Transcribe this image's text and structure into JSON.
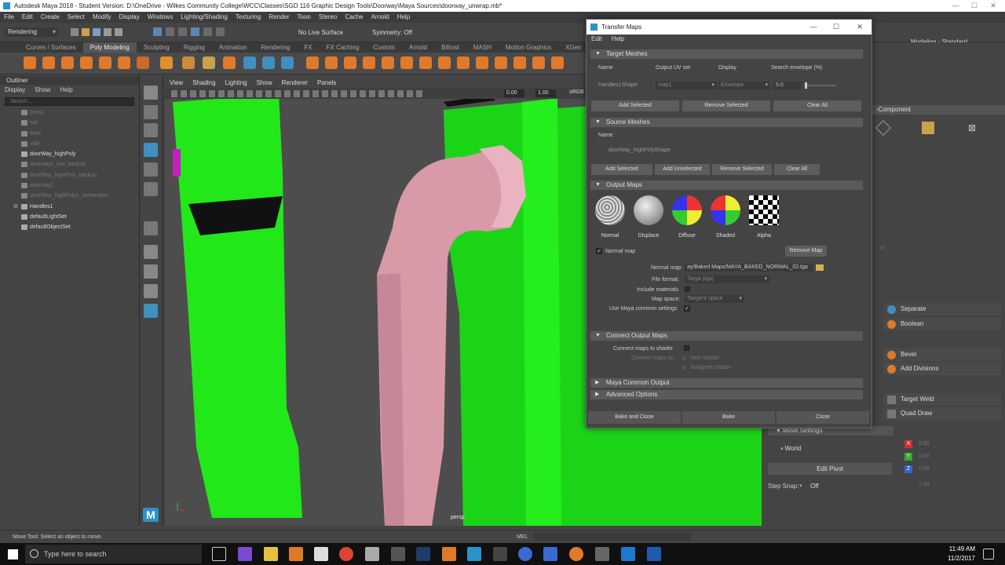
{
  "window": {
    "title": "Autodesk Maya 2018 - Student Version: D:\\OneDrive - Wilkes Community College\\WCC\\Classes\\SGD 116 Graphic Design Tools\\Doorway\\Maya Sources\\doorway_unwrap.mb*",
    "min": "—",
    "max": "☐",
    "close": "✕"
  },
  "menubar": [
    "File",
    "Edit",
    "Create",
    "Select",
    "Modify",
    "Display",
    "Windows",
    "Lighting/Shading",
    "Texturing",
    "Render",
    "Toon",
    "Stereo",
    "Cache",
    "Arnold",
    "Help"
  ],
  "statusline": {
    "menuset": "Rendering",
    "live_surface": "No Live Surface",
    "symmetry": "Symmetry: Off",
    "workspace": "Modeling - Standard"
  },
  "shelf_tabs": [
    "Curves / Surfaces",
    "Poly Modeling",
    "Sculpting",
    "Rigging",
    "Animation",
    "Rendering",
    "FX",
    "FX Caching",
    "Custom",
    "Arnold",
    "Bifrost",
    "MASH",
    "Motion Graphics",
    "XGen"
  ],
  "shelf_active": "Poly Modeling",
  "outliner": {
    "title": "Outliner",
    "menu": [
      "Display",
      "Show",
      "Help"
    ],
    "search_placeholder": "Search...",
    "items": [
      {
        "label": "persp",
        "dim": true
      },
      {
        "label": "top",
        "dim": true
      },
      {
        "label": "front",
        "dim": true
      },
      {
        "label": "side",
        "dim": true
      },
      {
        "label": "doorWay_highPoly",
        "dim": false
      },
      {
        "label": "doorway1_low_backup",
        "dim": true
      },
      {
        "label": "doorWay_highPoly_backup",
        "dim": true
      },
      {
        "label": "doorway1",
        "dim": true
      },
      {
        "label": "doorWay_highPoly1_noHandles",
        "dim": true
      },
      {
        "label": "Handles1",
        "dim": false
      },
      {
        "label": "defaultLightSet",
        "dim": false
      },
      {
        "label": "defaultObjectSet",
        "dim": false
      }
    ]
  },
  "viewport": {
    "menu": [
      "View",
      "Shading",
      "Lighting",
      "Show",
      "Renderer",
      "Panels"
    ],
    "field1": "0.00",
    "field2": "1.00",
    "colorspace": "sRGB",
    "camera_label": "persp"
  },
  "dialog": {
    "title": "Transfer Maps",
    "menu": [
      "Edit",
      "Help"
    ],
    "target": {
      "header": "Target Meshes",
      "col_name": "Name",
      "col_uv": "Output UV set",
      "col_display": "Display",
      "col_envelope": "Search envelope (%)",
      "row_name": "Handles1Shape",
      "row_uv": "map1",
      "row_display": "Envelope",
      "row_envelope": "5.0",
      "btn_add": "Add Selected",
      "btn_remove": "Remove Selected",
      "btn_clear": "Clear All"
    },
    "source": {
      "header": "Source Meshes",
      "col_name": "Name",
      "row_name": "doorWay_highPolyShape",
      "btn_add": "Add Selected",
      "btn_add_unsel": "Add Unselected",
      "btn_remove": "Remove Selected",
      "btn_clear": "Clear All"
    },
    "output": {
      "header": "Output Maps",
      "maps": [
        "Normal",
        "Displace",
        "Diffuse",
        "Shaded",
        "Alpha"
      ],
      "normal_map_check": "Normal map",
      "btn_remove_map": "Remove Map",
      "normal_map_label": "Normal map:",
      "normal_map_path": "ay/Baked Maps/MAYA_BAKED_NORMAL_02.tga",
      "file_format_label": "File format:",
      "file_format": "Targa (tga)",
      "include_materials_label": "Include materials",
      "map_space_label": "Map space:",
      "map_space": "Tangent space",
      "common_settings_label": "Use Maya common settings",
      "check": "✓"
    },
    "connect": {
      "header": "Connect Output Maps",
      "connect_label": "Connect maps to shader",
      "connect_to_label": "Connect maps to:",
      "new_shader": "New shader",
      "assigned_shader": "Assigned shader"
    },
    "common_header": "Maya Common Output",
    "advanced_header": "Advanced Options",
    "btn_bake_close": "Bake and Close",
    "btn_bake": "Bake",
    "btn_close": "Close"
  },
  "rightpanel": {
    "component": "-Component",
    "separate": "Separate",
    "boolean": "Boolean",
    "bevel": "Bevel",
    "add_divisions": "Add Divisions",
    "target_weld": "Target Weld",
    "quad_draw": "Quad Draw",
    "move_settings": "Move Settings",
    "world": "World",
    "edit_pivot": "Edit Pivot",
    "step_snap_label": "Step Snap:",
    "step_snap": "Off",
    "x": "X",
    "y": "Y",
    "z": "Z",
    "zero": "0.00",
    "one": "1.00",
    "side_zero": "0"
  },
  "helpline": {
    "text": "Move Tool: Select an object to move.",
    "mel": "MEL"
  },
  "taskbar": {
    "search": "Type here to search",
    "time": "11:49 AM",
    "date": "11/2/2017"
  },
  "colors": {
    "green": "#22e81a",
    "pink": "#d79aa6",
    "viewport_bg": "#4d4d4d",
    "maya_blue": "#2a93c9"
  }
}
